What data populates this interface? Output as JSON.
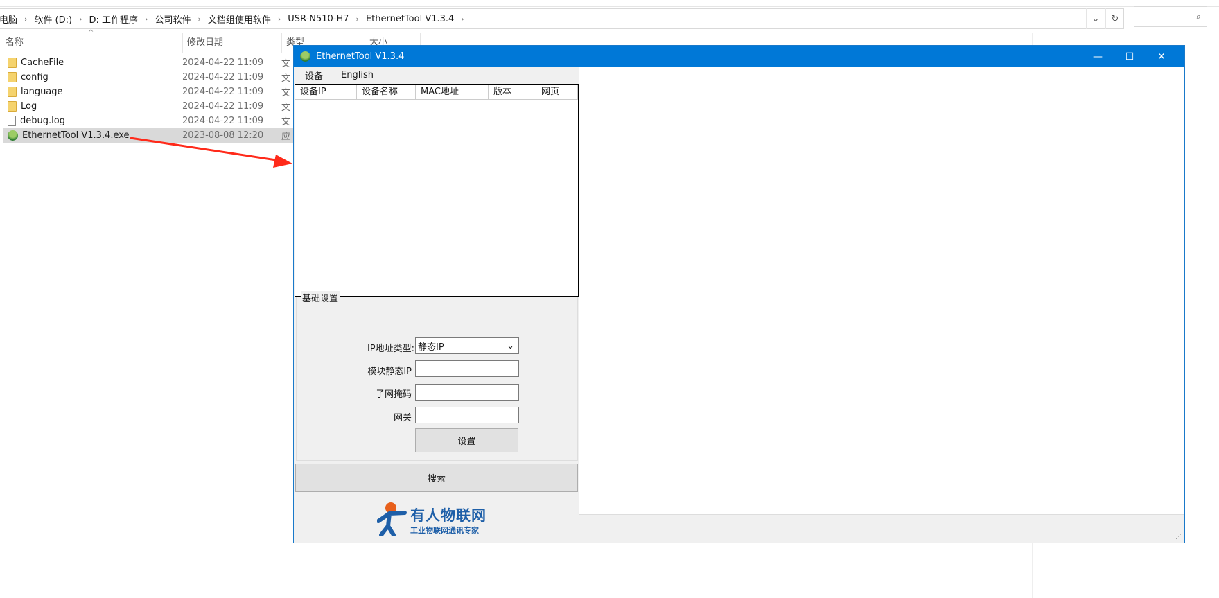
{
  "explorer": {
    "breadcrumb": [
      "此电脑",
      "软件 (D:)",
      "D: 工作程序",
      "公司软件",
      "文档组使用软件",
      "USR-N510-H7",
      "EthernetTool V1.3.4"
    ],
    "columns": [
      "名称",
      "修改日期",
      "类型",
      "大小"
    ],
    "files": [
      {
        "name": "CacheFile",
        "date": "2024-04-22 11:09",
        "type": "文",
        "icon": "folder-icon"
      },
      {
        "name": "config",
        "date": "2024-04-22 11:09",
        "type": "文",
        "icon": "folder-icon"
      },
      {
        "name": "language",
        "date": "2024-04-22 11:09",
        "type": "文",
        "icon": "folder-icon"
      },
      {
        "name": "Log",
        "date": "2024-04-22 11:09",
        "type": "文",
        "icon": "folder-icon"
      },
      {
        "name": "debug.log",
        "date": "2024-04-22 11:09",
        "type": "文",
        "icon": "file-icon"
      },
      {
        "name": "EthernetTool V1.3.4.exe",
        "date": "2023-08-08 12:20",
        "type": "应",
        "icon": "app-icon",
        "selected": true
      }
    ],
    "arrow_color": "#ff2a1a"
  },
  "app": {
    "title": "EthernetTool V1.3.4",
    "title_color": "#0078d7",
    "menu": [
      "设备",
      "English"
    ],
    "list_columns": [
      "设备IP",
      "设备名称",
      "MAC地址",
      "版本",
      "网页"
    ],
    "group_title": "基础设置",
    "ip_type_label": "IP地址类型:",
    "ip_type_value": "静态IP",
    "static_ip_label": "模块静态IP",
    "subnet_label": "子网掩码",
    "gateway_label": "网关",
    "set_button": "设置",
    "search_button": "搜索",
    "logo": {
      "name": "有人物联网",
      "tagline": "工业物联网通讯专家",
      "color": "#1e5fa8"
    }
  }
}
